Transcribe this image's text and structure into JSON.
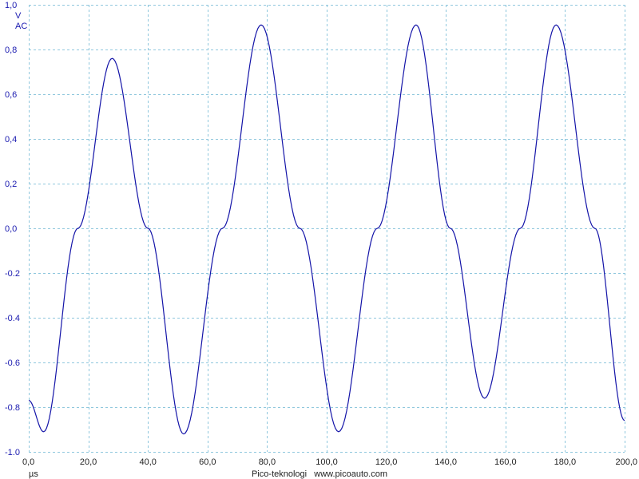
{
  "chart_data": {
    "type": "line",
    "title": "",
    "y_unit": "V",
    "coupling": "AC",
    "x_unit": "µs",
    "credit": "Pico-teknologi   www.picoauto.com",
    "xlim": [
      0,
      200
    ],
    "ylim": [
      -1.0,
      1.0
    ],
    "grid": true,
    "x_ticks": [
      0,
      20,
      40,
      60,
      80,
      100,
      120,
      140,
      160,
      180,
      200
    ],
    "x_tick_labels": [
      "0,0",
      "20,0",
      "40,0",
      "60,0",
      "80,0",
      "100,0",
      "120,0",
      "140,0",
      "160,0",
      "180,0",
      "200,0"
    ],
    "y_ticks": [
      1.0,
      0.8,
      0.6,
      0.4,
      0.2,
      0.0,
      -0.2,
      -0.4,
      -0.6,
      -0.8,
      -1.0
    ],
    "y_tick_labels": [
      "1,0",
      "0,8",
      "0,6",
      "0,4",
      "0,2",
      "0,0",
      "-0.2",
      "-0.4",
      "-0.6",
      "-0.8",
      "-1.0"
    ],
    "series": [
      {
        "color": "#1414a8",
        "x": [
          0,
          5,
          16.5,
          28,
          40,
          52,
          65,
          78,
          91,
          104,
          117,
          130,
          141.5,
          153,
          165,
          177,
          190,
          200
        ],
        "y": [
          -0.77,
          -0.91,
          0.0,
          0.76,
          0.0,
          -0.92,
          0.0,
          0.91,
          0.0,
          -0.91,
          0.0,
          0.91,
          0.0,
          -0.76,
          0.0,
          0.91,
          0.0,
          -0.86
        ]
      }
    ]
  }
}
